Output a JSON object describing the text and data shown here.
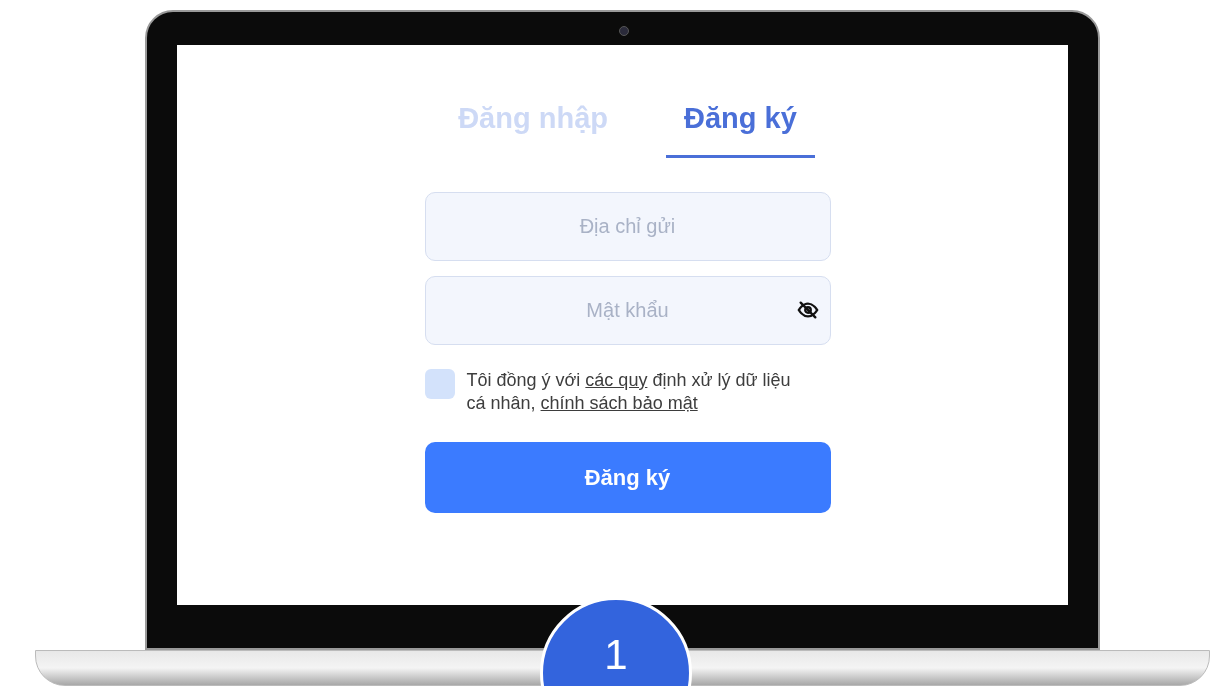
{
  "tabs": [
    {
      "label": "Đăng nhập",
      "selected": false
    },
    {
      "label": "Đăng ký",
      "selected": true
    }
  ],
  "fields": [
    {
      "kind": "text",
      "placeholder": "Địa chỉ gửi"
    },
    {
      "kind": "password",
      "placeholder": "Mật khẩu"
    }
  ],
  "consent": {
    "checked": false,
    "parts": [
      {
        "kind": "text",
        "text": "Tôi đồng ý với "
      },
      {
        "kind": "link",
        "text": "các quy"
      },
      {
        "kind": "text",
        "text": " định xử lý dữ liệu cá nhân, "
      },
      {
        "kind": "link",
        "text": "chính sách bảo mật"
      }
    ]
  },
  "submit_button": "Đăng ký",
  "step_badge": "1"
}
